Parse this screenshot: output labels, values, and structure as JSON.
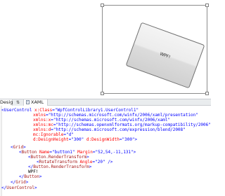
{
  "design": {
    "button_content": "WPF!",
    "rotation_angle_deg": 20
  },
  "tabs": {
    "design_label": "Design",
    "swap_label": "⇅",
    "xaml_label": "XAML"
  },
  "code": {
    "l1": {
      "tag": "<UserControl",
      "attr": "x:Class",
      "eq": "=",
      "val": "\"WpfControlLibrary1.UserControl1\""
    },
    "l2": {
      "attr": "xmlns",
      "eq": "=",
      "val": "\"http://schemas.microsoft.com/winfx/2006/xaml/presentation\""
    },
    "l3": {
      "attr": "xmlns:x",
      "eq": "=",
      "val": "\"http://schemas.microsoft.com/winfx/2006/xaml\""
    },
    "l4": {
      "attr": "xmlns:mc",
      "eq": "=",
      "val": "\"http://schemas.openxmlformats.org/markup-compatibility/2006\""
    },
    "l5": {
      "attr": "xmlns:d",
      "eq": "=",
      "val": "\"http://schemas.microsoft.com/expression/blend/2008\""
    },
    "l6": {
      "attr": "mc:Ignorable",
      "eq": "=",
      "val": "\"d\""
    },
    "l7": {
      "attr": "d:DesignHeight",
      "eq": "=",
      "val": "\"300\"",
      "attr2": "d:DesignWidth",
      "eq2": "=",
      "val2": "\"300\"",
      "close": ">"
    },
    "l8": {
      "open": "<",
      "tag": "Grid",
      "close": ">"
    },
    "l9": {
      "open": "<",
      "tag": "Button",
      "attr": "Name",
      "eq": "=",
      "val": "\"button1\"",
      "attr2": "Margin",
      "eq2": "=",
      "val2": "\"52,54,-11,131\"",
      "close": ">"
    },
    "l10": {
      "open": "<",
      "tag": "Button.RenderTransform",
      "close": ">"
    },
    "l11": {
      "open": "<",
      "tag": "RotateTransform",
      "attr": "Angle",
      "eq": "=",
      "val": "\"20\"",
      "close": " />"
    },
    "l12": {
      "open": "</",
      "tag": "Button.RenderTransform",
      "close": ">"
    },
    "l13": {
      "text": "WPF!"
    },
    "l14": {
      "open": "</",
      "tag": "Button",
      "close": ">"
    },
    "l15": {
      "open": "</",
      "tag": "Grid",
      "close": ">"
    },
    "l16": {
      "open": "</",
      "tag": "UserControl",
      "close": ">"
    }
  }
}
